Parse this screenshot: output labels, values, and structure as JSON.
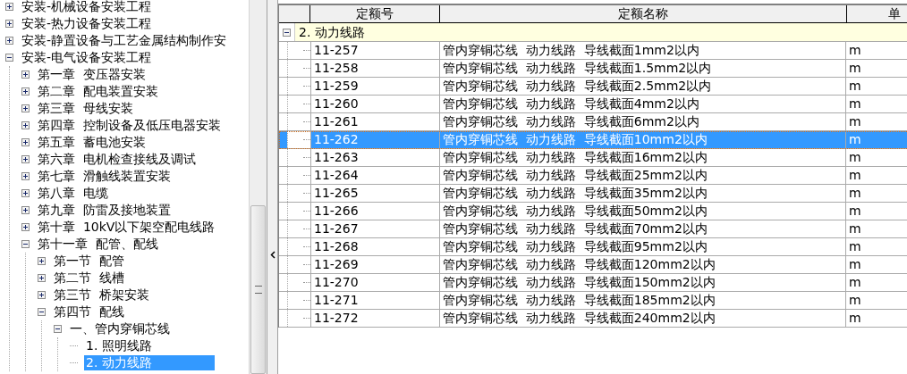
{
  "tree": {
    "items": [
      {
        "label": "安装-机械设备安装工程",
        "expanded": false,
        "selected": false
      },
      {
        "label": "安装-热力设备安装工程",
        "expanded": false,
        "selected": false
      },
      {
        "label": "安装-静置设备与工艺金属结构制作安",
        "expanded": false,
        "selected": false
      },
      {
        "label": "安装-电气设备安装工程",
        "expanded": true,
        "selected": false,
        "children": [
          {
            "label": "第一章  变压器安装",
            "expanded": false,
            "selected": false
          },
          {
            "label": "第二章  配电装置安装",
            "expanded": false,
            "selected": false
          },
          {
            "label": "第三章  母线安装",
            "expanded": false,
            "selected": false
          },
          {
            "label": "第四章  控制设备及低压电器安装",
            "expanded": false,
            "selected": false
          },
          {
            "label": "第五章  蓄电池安装",
            "expanded": false,
            "selected": false
          },
          {
            "label": "第六章  电机检查接线及调试",
            "expanded": false,
            "selected": false
          },
          {
            "label": "第七章  滑触线装置安装",
            "expanded": false,
            "selected": false
          },
          {
            "label": "第八章  电缆",
            "expanded": false,
            "selected": false
          },
          {
            "label": "第九章  防雷及接地装置",
            "expanded": false,
            "selected": false
          },
          {
            "label": "第十章  10kV以下架空配电线路",
            "expanded": false,
            "selected": false
          },
          {
            "label": "第十一章  配管、配线",
            "expanded": true,
            "selected": false,
            "children": [
              {
                "label": "第一节  配管",
                "expanded": false,
                "selected": false
              },
              {
                "label": "第二节  线槽",
                "expanded": false,
                "selected": false
              },
              {
                "label": "第三节  桥架安装",
                "expanded": false,
                "selected": false
              },
              {
                "label": "第四节  配线",
                "expanded": true,
                "selected": false,
                "children": [
                  {
                    "label": "一、管内穿铜芯线",
                    "expanded": true,
                    "selected": false,
                    "children": [
                      {
                        "label": "1. 照明线路",
                        "selected": false
                      },
                      {
                        "label": "2. 动力线路",
                        "selected": true
                      }
                    ]
                  }
                ]
              }
            ]
          }
        ]
      }
    ]
  },
  "table": {
    "columns": [
      "定额号",
      "定额名称",
      "单"
    ],
    "group": {
      "label": "2. 动力线路",
      "expanded": true
    },
    "rows": [
      {
        "code": "11-257",
        "name": "管内穿铜芯线  动力线路  导线截面1mm2以内",
        "unit": "m",
        "selected": false
      },
      {
        "code": "11-258",
        "name": "管内穿铜芯线  动力线路  导线截面1.5mm2以内",
        "unit": "m",
        "selected": false
      },
      {
        "code": "11-259",
        "name": "管内穿铜芯线  动力线路  导线截面2.5mm2以内",
        "unit": "m",
        "selected": false
      },
      {
        "code": "11-260",
        "name": "管内穿铜芯线  动力线路  导线截面4mm2以内",
        "unit": "m",
        "selected": false
      },
      {
        "code": "11-261",
        "name": "管内穿铜芯线  动力线路  导线截面6mm2以内",
        "unit": "m",
        "selected": false
      },
      {
        "code": "11-262",
        "name": "管内穿铜芯线  动力线路  导线截面10mm2以内",
        "unit": "m",
        "selected": true
      },
      {
        "code": "11-263",
        "name": "管内穿铜芯线  动力线路  导线截面16mm2以内",
        "unit": "m",
        "selected": false
      },
      {
        "code": "11-264",
        "name": "管内穿铜芯线  动力线路  导线截面25mm2以内",
        "unit": "m",
        "selected": false
      },
      {
        "code": "11-265",
        "name": "管内穿铜芯线  动力线路  导线截面35mm2以内",
        "unit": "m",
        "selected": false
      },
      {
        "code": "11-266",
        "name": "管内穿铜芯线  动力线路  导线截面50mm2以内",
        "unit": "m",
        "selected": false
      },
      {
        "code": "11-267",
        "name": "管内穿铜芯线  动力线路  导线截面70mm2以内",
        "unit": "m",
        "selected": false
      },
      {
        "code": "11-268",
        "name": "管内穿铜芯线  动力线路  导线截面95mm2以内",
        "unit": "m",
        "selected": false
      },
      {
        "code": "11-269",
        "name": "管内穿铜芯线  动力线路  导线截面120mm2以内",
        "unit": "m",
        "selected": false
      },
      {
        "code": "11-270",
        "name": "管内穿铜芯线  动力线路  导线截面150mm2以内",
        "unit": "m",
        "selected": false
      },
      {
        "code": "11-271",
        "name": "管内穿铜芯线  动力线路  导线截面185mm2以内",
        "unit": "m",
        "selected": false
      },
      {
        "code": "11-272",
        "name": "管内穿铜芯线  动力线路  导线截面240mm2以内",
        "unit": "m",
        "selected": false
      }
    ]
  }
}
